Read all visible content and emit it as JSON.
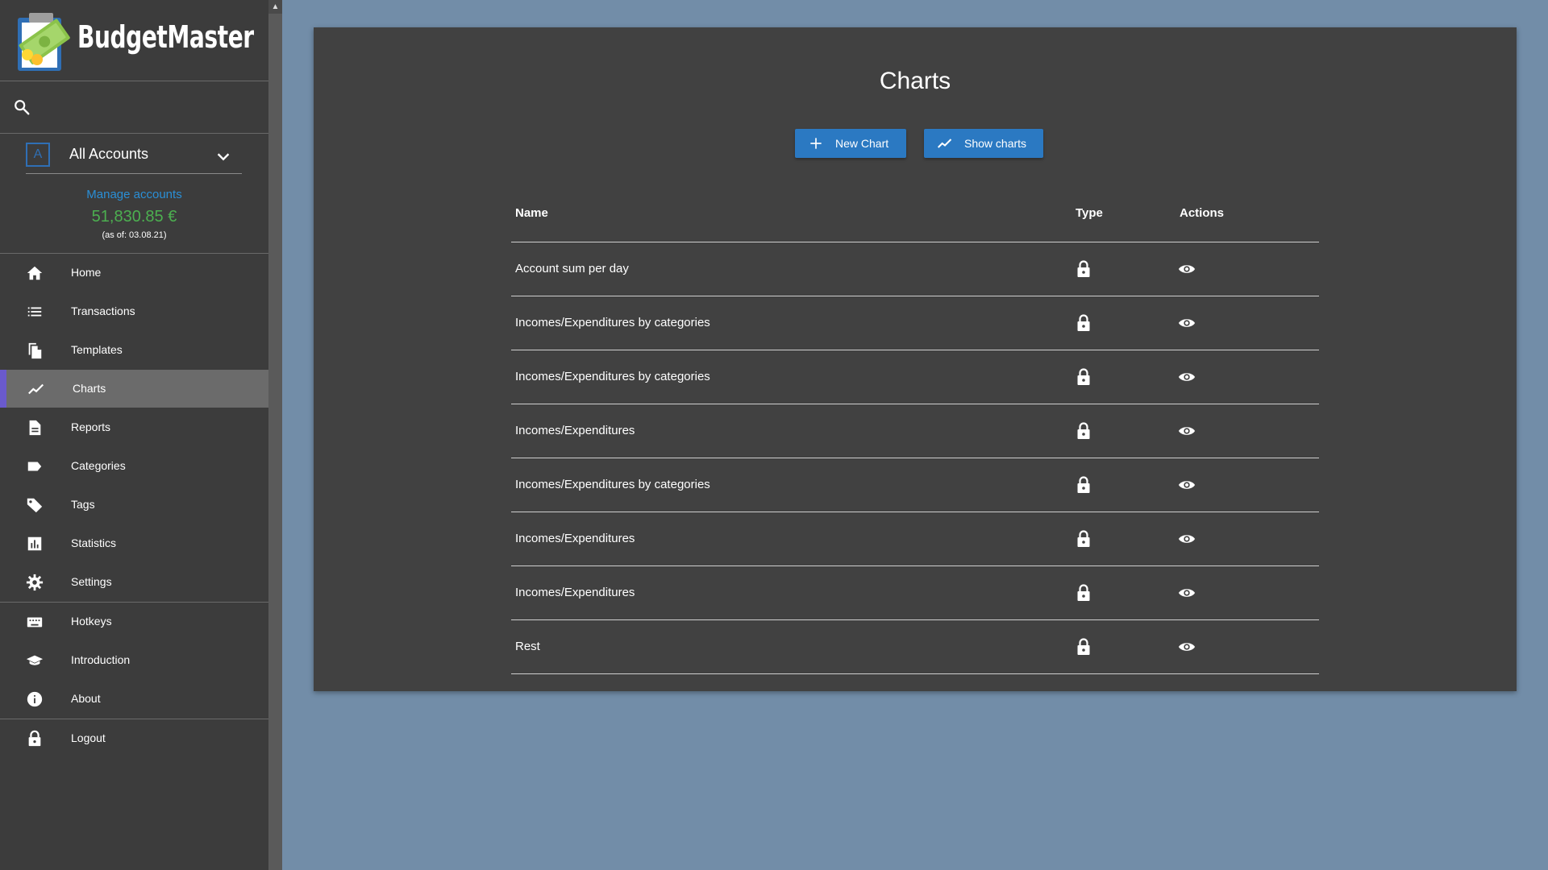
{
  "app": {
    "title": "BudgetMaster"
  },
  "sidebar": {
    "account": {
      "badge": "A",
      "label": "All Accounts"
    },
    "manage_accounts": "Manage accounts",
    "balance": "51,830.85 €",
    "as_of": "(as of: 03.08.21)",
    "nav": [
      {
        "label": "Home",
        "icon": "home-icon"
      },
      {
        "label": "Transactions",
        "icon": "list-icon"
      },
      {
        "label": "Templates",
        "icon": "file-copy-icon"
      },
      {
        "label": "Charts",
        "icon": "chart-line-icon",
        "active": true
      },
      {
        "label": "Reports",
        "icon": "document-icon"
      },
      {
        "label": "Categories",
        "icon": "label-icon"
      },
      {
        "label": "Tags",
        "icon": "tag-icon"
      },
      {
        "label": "Statistics",
        "icon": "bar-chart-icon"
      },
      {
        "label": "Settings",
        "icon": "gear-icon"
      },
      {
        "label": "Hotkeys",
        "icon": "keyboard-icon"
      },
      {
        "label": "Introduction",
        "icon": "school-icon"
      },
      {
        "label": "About",
        "icon": "info-icon"
      },
      {
        "label": "Logout",
        "icon": "lock-icon"
      }
    ]
  },
  "main": {
    "title": "Charts",
    "buttons": {
      "new_chart": "New Chart",
      "show_charts": "Show charts"
    },
    "table": {
      "headers": {
        "name": "Name",
        "type": "Type",
        "actions": "Actions"
      },
      "rows": [
        {
          "name": "Account sum per day",
          "type_icon": "lock-icon",
          "action_icon": "eye-icon"
        },
        {
          "name": "Incomes/Expenditures by categories",
          "type_icon": "lock-icon",
          "action_icon": "eye-icon"
        },
        {
          "name": "Incomes/Expenditures by categories",
          "type_icon": "lock-icon",
          "action_icon": "eye-icon"
        },
        {
          "name": "Incomes/Expenditures",
          "type_icon": "lock-icon",
          "action_icon": "eye-icon"
        },
        {
          "name": "Incomes/Expenditures by categories",
          "type_icon": "lock-icon",
          "action_icon": "eye-icon"
        },
        {
          "name": "Incomes/Expenditures",
          "type_icon": "lock-icon",
          "action_icon": "eye-icon"
        },
        {
          "name": "Incomes/Expenditures",
          "type_icon": "lock-icon",
          "action_icon": "eye-icon"
        },
        {
          "name": "Rest",
          "type_icon": "lock-icon",
          "action_icon": "eye-icon"
        }
      ]
    }
  },
  "colors": {
    "background": "#728da8",
    "sidebar": "#3c3c3c",
    "card": "#414141",
    "accent_blue": "#2b79c2",
    "balance_green": "#4caf50",
    "link_blue": "#2a8fd6",
    "active_indicator": "#6a5acd"
  }
}
